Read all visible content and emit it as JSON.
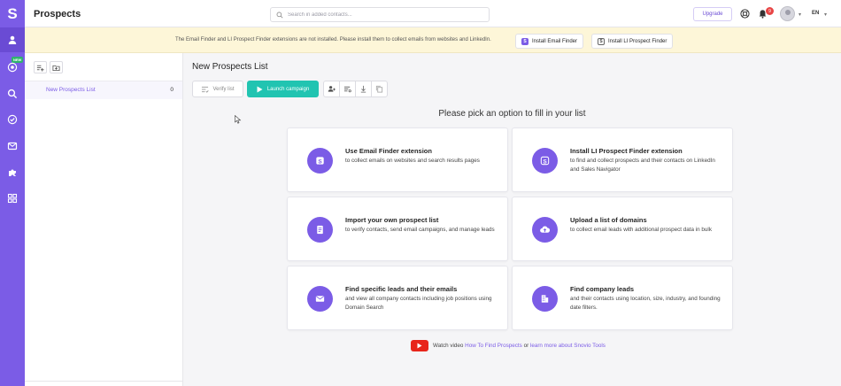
{
  "app": {
    "logo_letter": "S",
    "new_badge": "NEW"
  },
  "header": {
    "title": "Prospects",
    "search_placeholder": "Search in added contacts...",
    "upgrade_label": "Upgrade",
    "notification_count": "9",
    "language": "EN"
  },
  "banner": {
    "message": "The Email Finder and LI Prospect Finder extensions are not installed. Please install them to collect emails from websites and LinkedIn.",
    "install_email_finder": "Install Email Finder",
    "install_li_finder": "Install LI Prospect Finder",
    "icon_letter": "S"
  },
  "lists": {
    "items": [
      {
        "name": "New Prospects List",
        "count": "0"
      }
    ]
  },
  "main": {
    "list_title": "New Prospects List",
    "verify_label": "Verify list",
    "launch_label": "Launch campaign",
    "pick_title": "Please pick an option to fill in your list",
    "cards": [
      {
        "title": "Use Email Finder extension",
        "desc": "to collect emails on websites and search results pages",
        "icon": "snovio-s-icon"
      },
      {
        "title": "Install LI Prospect Finder extension",
        "desc": "to find and collect prospects and their contacts on LinkedIn and Sales Navigator",
        "icon": "snovio-outline-s-icon"
      },
      {
        "title": "Import your own prospect list",
        "desc": "to verify contacts, send email campaigns, and manage leads",
        "icon": "document-list-icon"
      },
      {
        "title": "Upload a list of domains",
        "desc": "to collect email leads with additional prospect data in bulk",
        "icon": "cloud-upload-icon"
      },
      {
        "title": "Find specific leads and their emails",
        "desc": "and view all company contacts including job positions using Domain Search",
        "icon": "envelope-icon"
      },
      {
        "title": "Find company leads",
        "desc": "and their contacts using location, size, industry, and founding date filters.",
        "icon": "building-icon"
      }
    ],
    "watch": {
      "prefix": "Watch video",
      "video_link": "How To Find Prospects",
      "middle": "or",
      "tools_link": "learn more about Snovio Tools"
    }
  },
  "colors": {
    "accent": "#7b5ce6",
    "launch": "#21c4b1",
    "banner_bg": "#fdf6d8",
    "youtube": "#e8251b"
  }
}
